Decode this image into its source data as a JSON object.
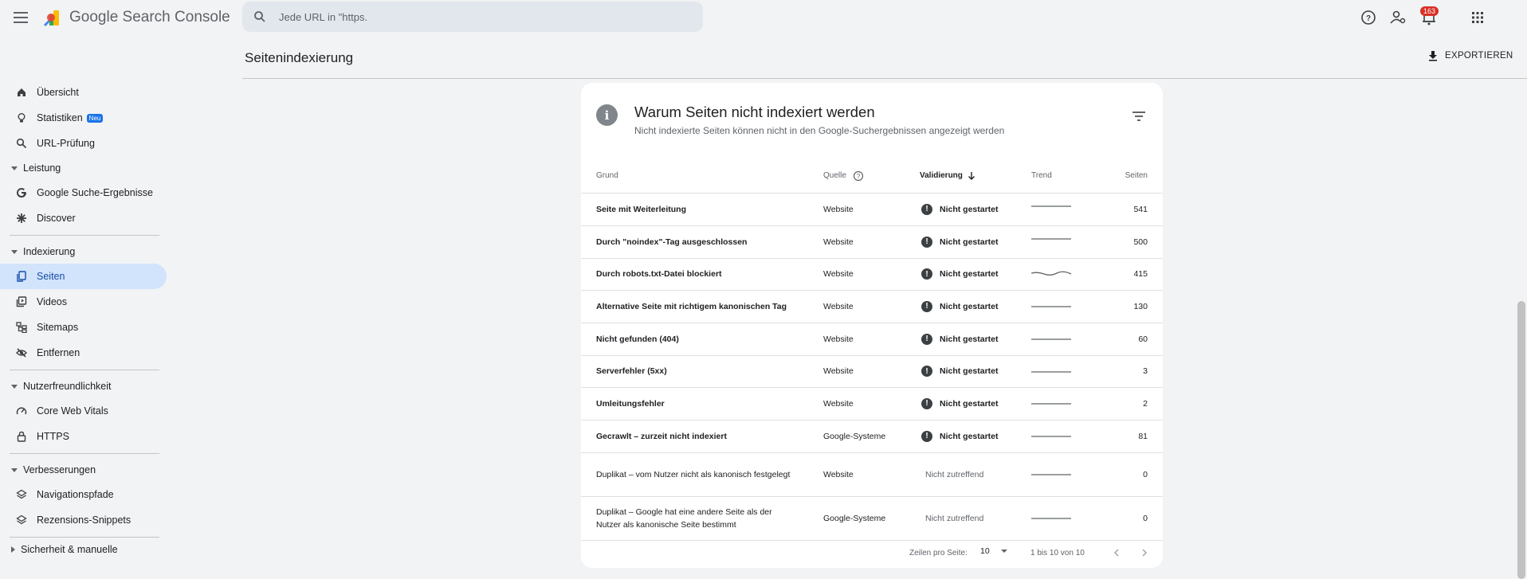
{
  "app": {
    "title": "Google Search Console"
  },
  "search": {
    "placeholder": "Jede URL in \"https."
  },
  "notifications": {
    "count": "163"
  },
  "sidebar": {
    "top_items": [
      {
        "label": "Übersicht",
        "icon": "home-icon"
      },
      {
        "label": "Statistiken",
        "icon": "lightbulb-icon",
        "badge": "Neu"
      },
      {
        "label": "URL-Prüfung",
        "icon": "search-icon"
      }
    ],
    "sections": [
      {
        "label": "Leistung",
        "items": [
          {
            "label": "Google Suche-Ergebnisse",
            "icon": "google-g-icon"
          },
          {
            "label": "Discover",
            "icon": "asterisk-icon"
          }
        ]
      },
      {
        "label": "Indexierung",
        "items": [
          {
            "label": "Seiten",
            "icon": "pages-icon",
            "active": true
          },
          {
            "label": "Videos",
            "icon": "video-icon"
          },
          {
            "label": "Sitemaps",
            "icon": "sitemap-icon"
          },
          {
            "label": "Entfernen",
            "icon": "eye-off-icon"
          }
        ]
      },
      {
        "label": "Nutzerfreundlichkeit",
        "items": [
          {
            "label": "Core Web Vitals",
            "icon": "gauge-icon"
          },
          {
            "label": "HTTPS",
            "icon": "lock-icon"
          }
        ]
      },
      {
        "label": "Verbesserungen",
        "items": [
          {
            "label": "Navigationspfade",
            "icon": "layers-icon"
          },
          {
            "label": "Rezensions-Snippets",
            "icon": "layers-icon"
          }
        ]
      },
      {
        "label": "Sicherheit & manuelle"
      }
    ]
  },
  "page": {
    "title": "Seitenindexierung",
    "export_label": "EXPORTIEREN"
  },
  "card": {
    "title": "Warum Seiten nicht indexiert werden",
    "subtitle": "Nicht indexierte Seiten können nicht in den Google-Suchergebnissen angezeigt werden",
    "columns": {
      "reason": "Grund",
      "source": "Quelle",
      "validation": "Validierung",
      "trend": "Trend",
      "pages": "Seiten"
    },
    "rows": [
      {
        "reason": "Seite mit Weiterleitung",
        "source": "Website",
        "validation": "Nicht gestartet",
        "status": "started",
        "trend": "flat-high",
        "pages": "541"
      },
      {
        "reason": "Durch \"noindex\"-Tag ausgeschlossen",
        "source": "Website",
        "validation": "Nicht gestartet",
        "status": "started",
        "trend": "flat-high",
        "pages": "500"
      },
      {
        "reason": "Durch robots.txt-Datei blockiert",
        "source": "Website",
        "validation": "Nicht gestartet",
        "status": "started",
        "trend": "wavy",
        "pages": "415"
      },
      {
        "reason": "Alternative Seite mit richtigem kanonischen Tag",
        "source": "Website",
        "validation": "Nicht gestartet",
        "status": "started",
        "trend": "flat",
        "pages": "130"
      },
      {
        "reason": "Nicht gefunden (404)",
        "source": "Website",
        "validation": "Nicht gestartet",
        "status": "started",
        "trend": "flat",
        "pages": "60"
      },
      {
        "reason": "Serverfehler (5xx)",
        "source": "Website",
        "validation": "Nicht gestartet",
        "status": "started",
        "trend": "flat",
        "pages": "3"
      },
      {
        "reason": "Umleitungsfehler",
        "source": "Website",
        "validation": "Nicht gestartet",
        "status": "started",
        "trend": "flat",
        "pages": "2"
      },
      {
        "reason": "Gecrawlt – zurzeit nicht indexiert",
        "source": "Google-Systeme",
        "validation": "Nicht gestartet",
        "status": "started",
        "trend": "flat",
        "pages": "81"
      },
      {
        "reason": "Duplikat – vom Nutzer nicht als kanonisch festgelegt",
        "source": "Website",
        "validation": "Nicht zutreffend",
        "status": "na",
        "trend": "flat",
        "pages": "0"
      },
      {
        "reason": "Duplikat – Google hat eine andere Seite als der Nutzer als kanonische Seite bestimmt",
        "source": "Google-Systeme",
        "validation": "Nicht zutreffend",
        "status": "na",
        "trend": "flat",
        "pages": "0"
      }
    ],
    "pagination": {
      "rows_label": "Zeilen pro Seite:",
      "rows_value": "10",
      "range": "1 bis 10 von 10"
    }
  },
  "colors": {
    "accent": "#1a73e8",
    "active_bg": "#d2e3fc",
    "badge": "#d93025"
  }
}
